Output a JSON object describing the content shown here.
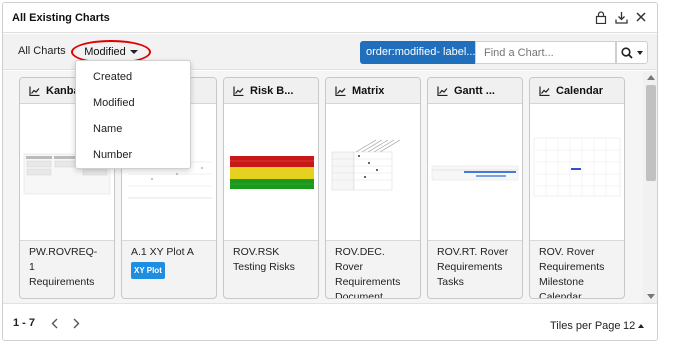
{
  "window": {
    "title": "All Existing Charts"
  },
  "toolbar": {
    "all_label": "All Charts",
    "sort_value": "Modified",
    "filter_chip": "order:modified- label...",
    "search_placeholder": "Find a Chart...",
    "highlight_color": "#e00000",
    "chip_color": "#1f6fbd"
  },
  "sort_menu": {
    "items": [
      "Created",
      "Modified",
      "Name",
      "Number"
    ]
  },
  "tiles": [
    {
      "title": "Kanba",
      "icon": "chart-icon",
      "footer": [
        "PW.ROVREQ-",
        "1",
        "Requirements"
      ],
      "preview": "kanban-preview"
    },
    {
      "title": "",
      "icon": "chart-icon",
      "footer": [
        "A.1 XY Plot A"
      ],
      "badge": "XY Plot",
      "preview": "xy-plot-preview"
    },
    {
      "title": "Risk B...",
      "icon": "chart-icon",
      "footer": [
        "ROV.RSK",
        "Testing Risks"
      ],
      "preview": "risk-board-preview"
    },
    {
      "title": "Matrix",
      "icon": "chart-icon",
      "footer": [
        "ROV.DEC.",
        "Rover",
        "Requirements",
        "Document"
      ],
      "preview": "matrix-preview"
    },
    {
      "title": "Gantt ...",
      "icon": "chart-icon",
      "footer": [
        "ROV.RT. Rover",
        "Requirements",
        "Tasks"
      ],
      "preview": "gantt-preview"
    },
    {
      "title": "Calendar",
      "icon": "chart-icon",
      "footer": [
        "ROV. Rover",
        "Requirements",
        "Milestone",
        "Calendar"
      ],
      "preview": "calendar-preview"
    }
  ],
  "footer": {
    "range": "1 - 7",
    "tiles_label": "Tiles per Page",
    "tiles_value": "12"
  }
}
